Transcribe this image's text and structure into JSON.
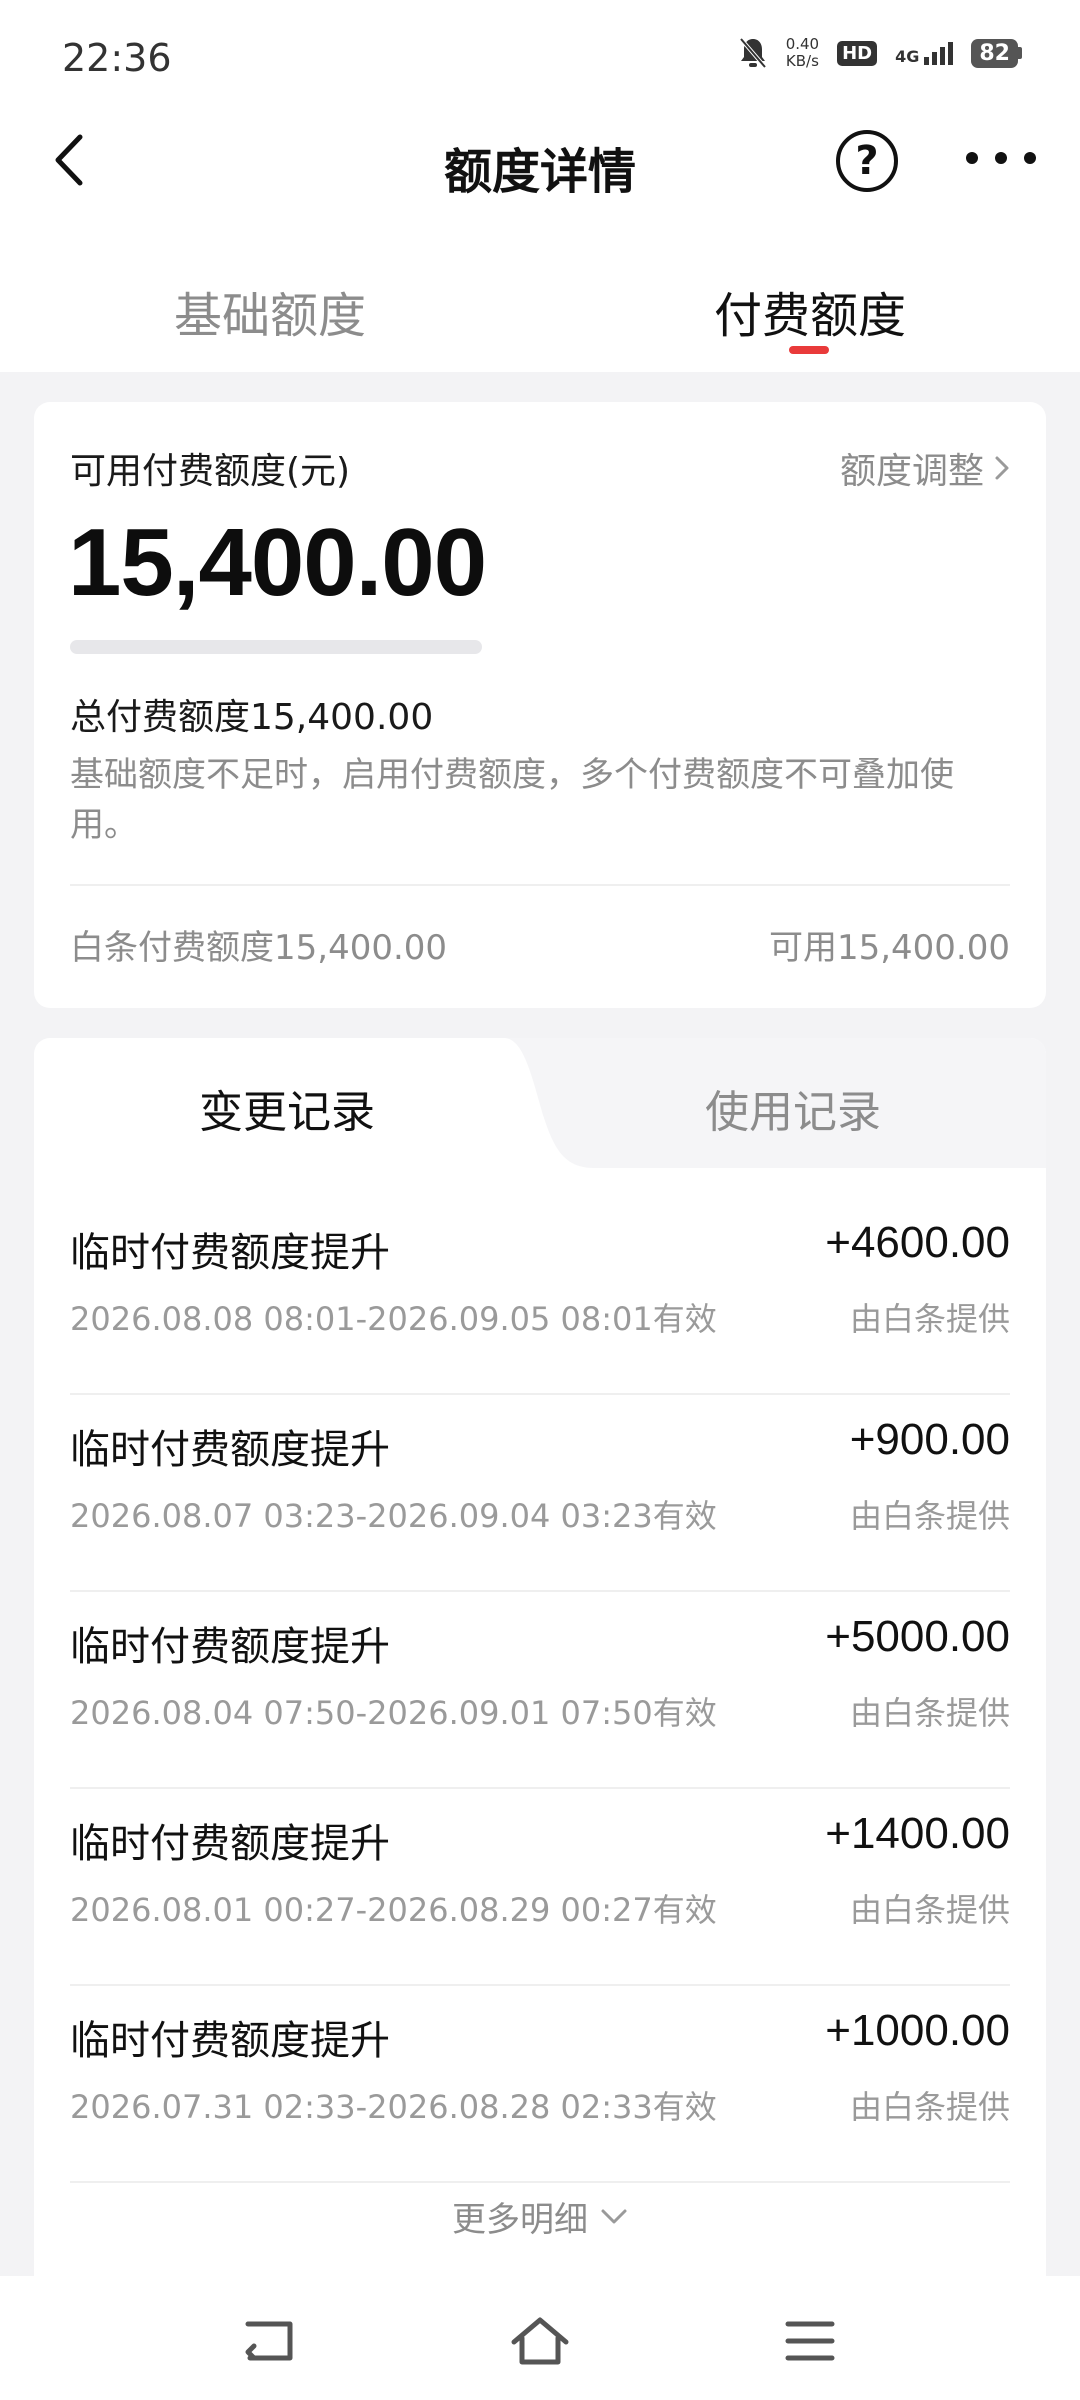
{
  "status_bar": {
    "time": "22:36",
    "net_speed_value": "0.40",
    "net_speed_unit": "KB/s",
    "hd_badge": "HD",
    "network_type": "4G",
    "battery": "82",
    "icons": [
      "mute-bell-icon",
      "hd-icon",
      "signal-icon",
      "battery-icon"
    ]
  },
  "nav": {
    "title": "额度详情",
    "help_glyph": "?",
    "icons": [
      "back-icon",
      "help-icon",
      "more-icon"
    ]
  },
  "main_tabs": {
    "items": [
      {
        "label": "基础额度",
        "active": false
      },
      {
        "label": "付费额度",
        "active": true
      }
    ],
    "accent_color": "#e93a3a"
  },
  "quota_card": {
    "label": "可用付费额度(元)",
    "adjust_label": "额度调整",
    "available_amount": "15,400.00",
    "used_fraction": 0,
    "total_label": "总付费额度15,400.00",
    "description": "基础额度不足时，启用付费额度，多个付费额度不可叠加使用。",
    "footer_left": "白条付费额度15,400.00",
    "footer_right": "可用15,400.00"
  },
  "records": {
    "tabs": [
      {
        "label": "变更记录",
        "active": true
      },
      {
        "label": "使用记录",
        "active": false
      }
    ],
    "items": [
      {
        "title": "临时付费额度提升",
        "period": "2026.08.08 08:01-2026.09.05 08:01有效",
        "amount": "+4600.00",
        "source": "由白条提供"
      },
      {
        "title": "临时付费额度提升",
        "period": "2026.08.07 03:23-2026.09.04 03:23有效",
        "amount": "+900.00",
        "source": "由白条提供"
      },
      {
        "title": "临时付费额度提升",
        "period": "2026.08.04 07:50-2026.09.01 07:50有效",
        "amount": "+5000.00",
        "source": "由白条提供"
      },
      {
        "title": "临时付费额度提升",
        "period": "2026.08.01 00:27-2026.08.29 00:27有效",
        "amount": "+1400.00",
        "source": "由白条提供"
      },
      {
        "title": "临时付费额度提升",
        "period": "2026.07.31 02:33-2026.08.28 02:33有效",
        "amount": "+1000.00",
        "source": "由白条提供"
      }
    ],
    "more_label": "更多明细"
  },
  "system_nav": {
    "icons": [
      "system-back-icon",
      "system-home-icon",
      "system-menu-icon"
    ]
  }
}
